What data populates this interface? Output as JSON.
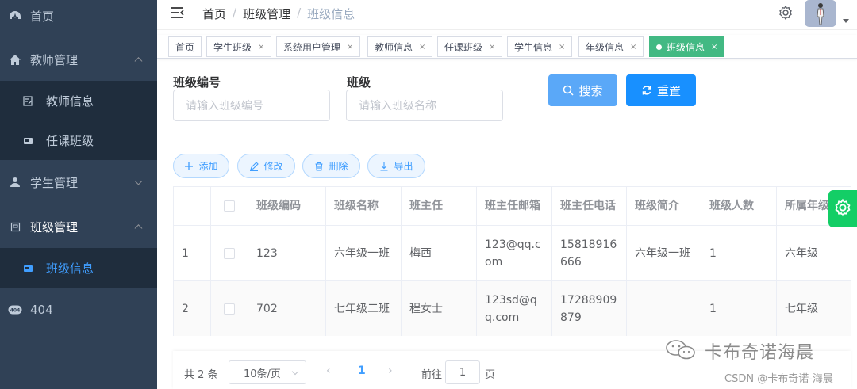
{
  "sidebar": {
    "items": [
      {
        "label": "首页",
        "icon": "dashboard-icon"
      },
      {
        "label": "教师管理",
        "icon": "home-icon",
        "expanded": true
      },
      {
        "label": "教师信息",
        "icon": "edit-doc-icon",
        "sub": true
      },
      {
        "label": "任课班级",
        "icon": "card-icon",
        "sub": true
      },
      {
        "label": "学生管理",
        "icon": "user-icon",
        "expanded": false
      },
      {
        "label": "班级管理",
        "icon": "class-icon",
        "expanded": true
      },
      {
        "label": "班级信息",
        "icon": "card-icon",
        "sub": true,
        "active": true
      },
      {
        "label": "404",
        "icon": "404-icon"
      }
    ]
  },
  "header": {
    "breadcrumb": [
      "首页",
      "班级管理",
      "班级信息"
    ],
    "separator": "/"
  },
  "tags": [
    {
      "label": "首页",
      "closable": false
    },
    {
      "label": "学生班级",
      "closable": true
    },
    {
      "label": "系统用户管理",
      "closable": true
    },
    {
      "label": "教师信息",
      "closable": true
    },
    {
      "label": "任课班级",
      "closable": true
    },
    {
      "label": "学生信息",
      "closable": true
    },
    {
      "label": "年级信息",
      "closable": true
    },
    {
      "label": "班级信息",
      "closable": true,
      "active": true
    }
  ],
  "tag_close": "×",
  "search": {
    "code_label": "班级编号",
    "code_placeholder": "请输入班级编号",
    "name_label": "班级",
    "name_placeholder": "请输入班级名称",
    "search_btn": "搜索",
    "reset_btn": "重置"
  },
  "actions": {
    "add": "添加",
    "edit": "修改",
    "delete": "删除",
    "export": "导出"
  },
  "table": {
    "columns": [
      "",
      "",
      "班级编码",
      "班级名称",
      "班主任",
      "班主任邮箱",
      "班主任电话",
      "班级简介",
      "班级人数",
      "所属年级"
    ],
    "rows": [
      [
        "1",
        "",
        "123",
        "六年级一班",
        "梅西",
        "123@qq.com",
        "15818916666",
        "六年级一班",
        "1",
        "六年级"
      ],
      [
        "2",
        "",
        "702",
        "七年级二班",
        "程女士",
        "123sd@qq.com",
        "17288909879",
        "",
        "1",
        "七年级"
      ]
    ]
  },
  "pagination": {
    "total": "共 2 条",
    "page_size": "10条/页",
    "prev": "‹",
    "current": "1",
    "next": "›",
    "goto_label": "前往",
    "goto_value": "1",
    "page_suffix": "页"
  },
  "watermark": {
    "brand": "卡布奇诺海晨",
    "csdn": "CSDN @卡布奇诺-海晨"
  },
  "colors": {
    "sidebar_bg": "#304156",
    "submenu_bg": "#1f2d3d",
    "primary": "#409eff",
    "search_btn": "#5aa8f8",
    "active_tag": "#42b983",
    "float_gear": "#13ce66"
  }
}
